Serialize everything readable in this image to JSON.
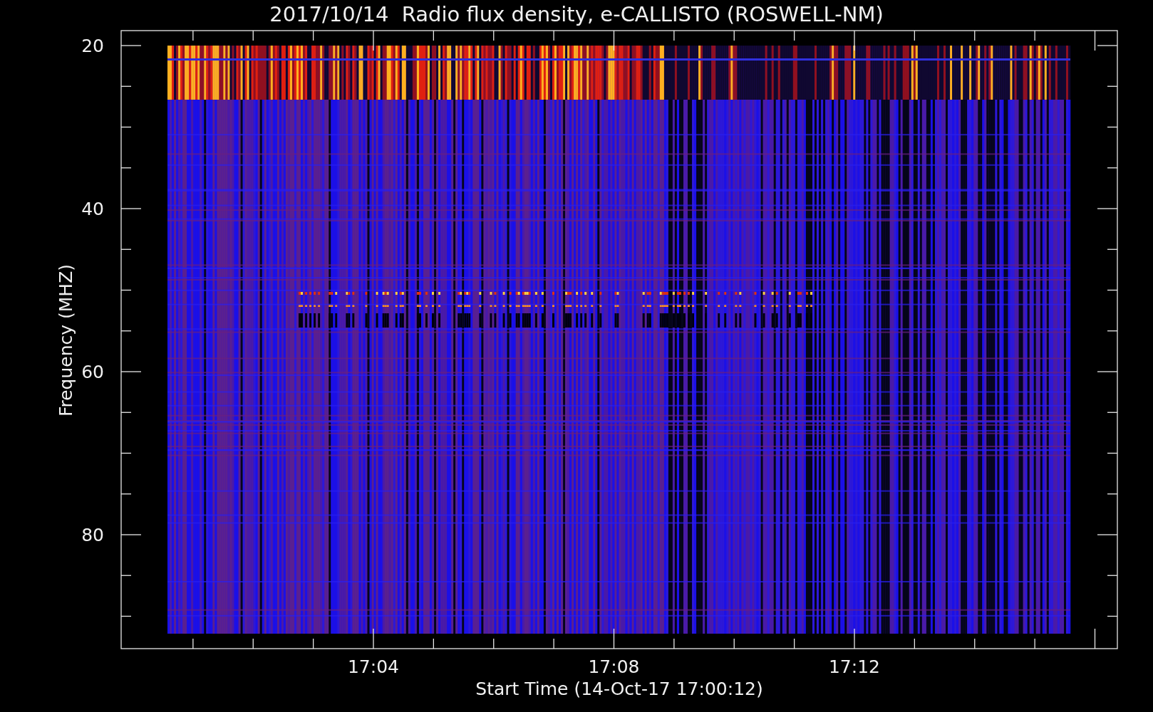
{
  "title": "2017/10/14  Radio flux density, e-CALLISTO (ROSWELL-NM)",
  "y_axis": {
    "label": "Frequency (MHZ)",
    "ticks": [
      "20",
      "40",
      "60",
      "80"
    ]
  },
  "x_axis": {
    "label": "Start Time (14-Oct-17 17:00:12)",
    "ticks": [
      "17:04",
      "17:08",
      "17:12"
    ]
  }
}
